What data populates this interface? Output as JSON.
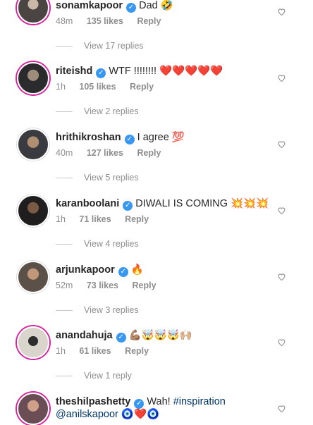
{
  "comments": [
    {
      "username": "sonamkapoor",
      "text": "Dad 🤣",
      "time": "48m",
      "likes": "135 likes",
      "reply": "Reply",
      "view_replies": "View 17 replies"
    },
    {
      "username": "riteishd",
      "text": "WTF !!!!!!!! ❤️❤️❤️❤️❤️",
      "time": "1h",
      "likes": "105 likes",
      "reply": "Reply",
      "view_replies": "View 2 replies"
    },
    {
      "username": "hrithikroshan",
      "text": "I agree 💯",
      "time": "40m",
      "likes": "127 likes",
      "reply": "Reply",
      "view_replies": "View 5 replies"
    },
    {
      "username": "karanboolani",
      "text": "DIWALI IS COMING 💥💥💥",
      "time": "1h",
      "likes": "71 likes",
      "reply": "Reply",
      "view_replies": "View 4 replies"
    },
    {
      "username": "arjunkapoor",
      "text": "🔥",
      "time": "52m",
      "likes": "73 likes",
      "reply": "Reply",
      "view_replies": "View 3 replies"
    },
    {
      "username": "anandahuja",
      "text": "💪🏽🤯🤯🤯🙌🏼",
      "time": "1h",
      "likes": "61 likes",
      "reply": "Reply",
      "view_replies": "View 1 reply"
    },
    {
      "username": "theshilpashetty",
      "text": "Wah!",
      "hashtag": "#inspiration",
      "mention": "@anilskapoor",
      "emoji_tail": "🧿❤️🧿"
    }
  ],
  "colors": {
    "verified": "#3897f0",
    "meta": "#8e8e8e",
    "link": "#003569",
    "story_ring": "#d6249f"
  }
}
